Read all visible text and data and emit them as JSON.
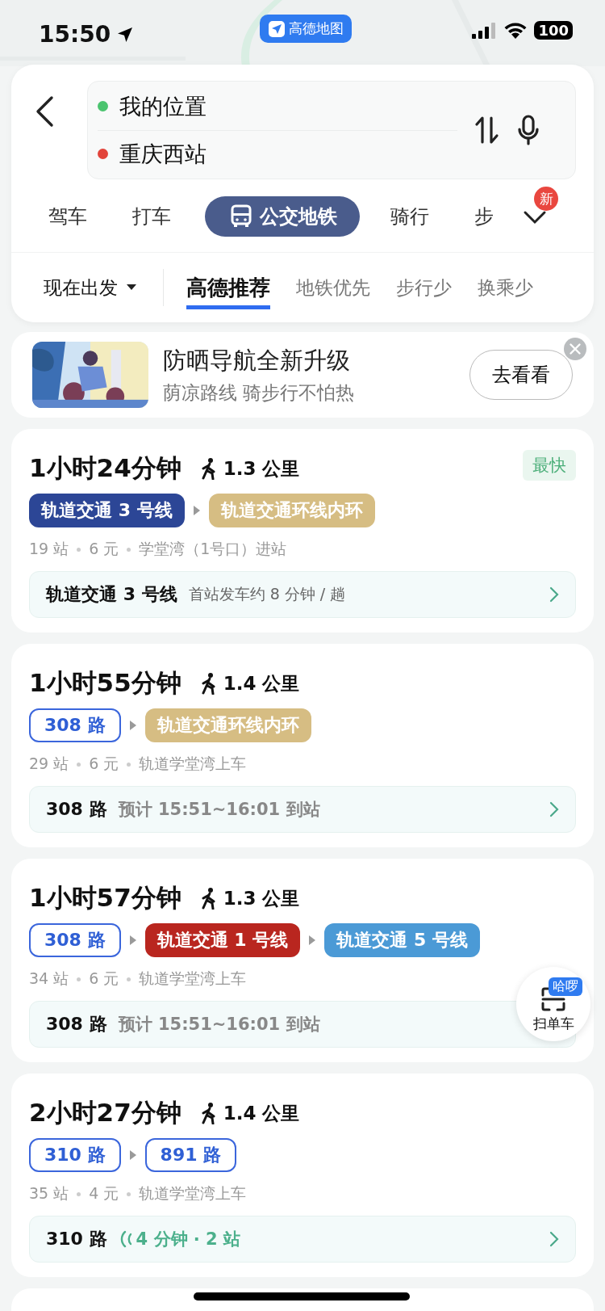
{
  "status_bar": {
    "time": "15:50",
    "app": "高德地图",
    "battery": "100"
  },
  "search": {
    "origin": "我的位置",
    "destination": "重庆西站"
  },
  "modes": [
    {
      "label": "驾车",
      "selected": false
    },
    {
      "label": "打车",
      "selected": false
    },
    {
      "label": "公交地铁",
      "selected": true
    },
    {
      "label": "骑行",
      "selected": false
    },
    {
      "label": "步",
      "selected": false
    }
  ],
  "new_badge": "新",
  "depart": "现在出发",
  "preferences": [
    {
      "label": "高德推荐",
      "selected": true
    },
    {
      "label": "地铁优先",
      "selected": false
    },
    {
      "label": "步行少",
      "selected": false
    },
    {
      "label": "换乘少",
      "selected": false
    }
  ],
  "banner": {
    "title": "防晒导航全新升级",
    "subtitle": "荫凉路线 骑步行不怕热",
    "button": "去看看"
  },
  "routes": [
    {
      "duration": "1小时24分钟",
      "walk": "1.3 公里",
      "badge": "最快",
      "segments": [
        {
          "kind": "rail",
          "label": "轨道交通 3 号线",
          "color": "#2c4696"
        },
        {
          "kind": "rail",
          "label": "轨道交通环线内环",
          "color": "#d6bd83"
        }
      ],
      "info": [
        "19 站",
        "6 元",
        "学堂湾（1号口）进站"
      ],
      "detail": {
        "line": "轨道交通 3 号线",
        "kind": "schedule",
        "note": "首站发车约 8 分钟 / 趟",
        "arrow": true
      }
    },
    {
      "duration": "1小时55分钟",
      "walk": "1.4 公里",
      "segments": [
        {
          "kind": "bus",
          "label": "308 路"
        },
        {
          "kind": "rail",
          "label": "轨道交通环线内环",
          "color": "#d6bd83"
        }
      ],
      "info": [
        "29 站",
        "6 元",
        "轨道学堂湾上车"
      ],
      "detail": {
        "line": "308 路",
        "kind": "eta",
        "note": "预计 15:51~16:01 到站",
        "arrow": true
      }
    },
    {
      "duration": "1小时57分钟",
      "walk": "1.3 公里",
      "segments": [
        {
          "kind": "bus",
          "label": "308 路"
        },
        {
          "kind": "rail",
          "label": "轨道交通 1 号线",
          "color": "#b9261f"
        },
        {
          "kind": "rail",
          "label": "轨道交通 5 号线",
          "color": "#4b9ad6"
        }
      ],
      "info": [
        "34 站",
        "6 元",
        "轨道学堂湾上车"
      ],
      "detail": {
        "line": "308 路",
        "kind": "eta",
        "note": "预计 15:51~16:01 到站"
      }
    },
    {
      "duration": "2小时27分钟",
      "walk": "1.4 公里",
      "segments": [
        {
          "kind": "bus",
          "label": "310 路"
        },
        {
          "kind": "bus",
          "label": "891 路"
        }
      ],
      "info": [
        "35 站",
        "4 元",
        "轨道学堂湾上车"
      ],
      "detail": {
        "line": "310 路",
        "kind": "realtime",
        "note": "4 分钟 · 2 站",
        "arrow": true
      }
    }
  ],
  "scan": {
    "label": "扫单车",
    "badge": "哈啰"
  }
}
